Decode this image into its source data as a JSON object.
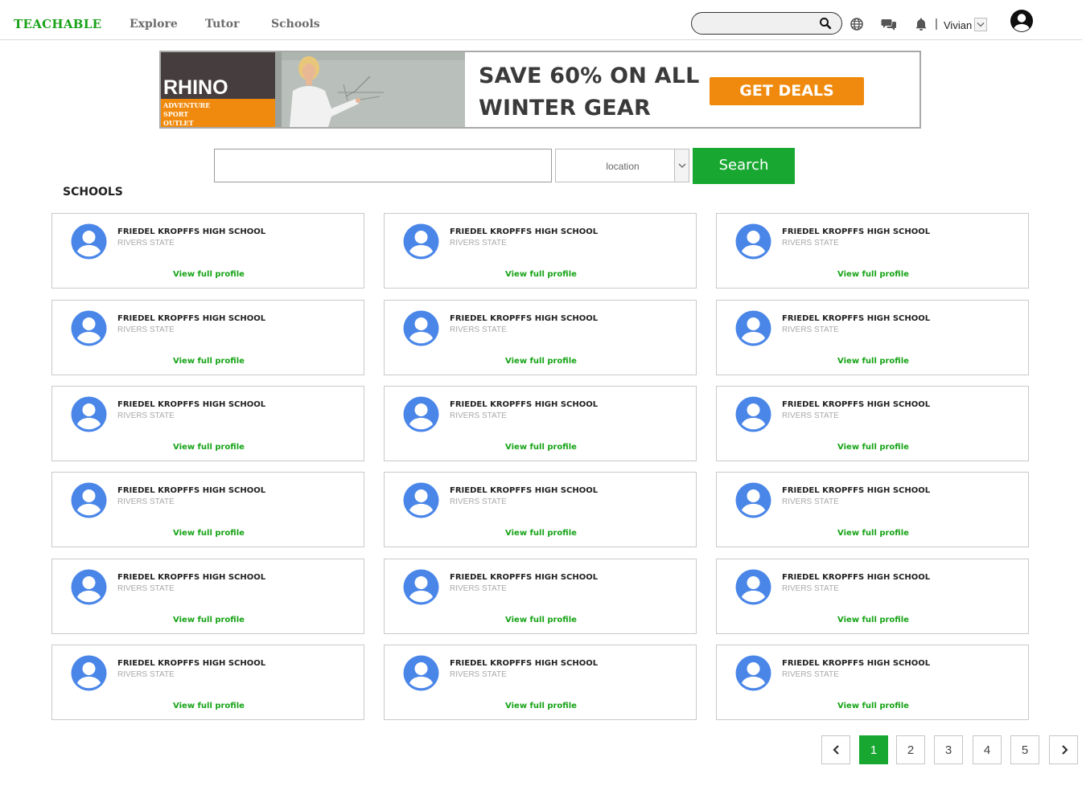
{
  "header": {
    "brand": "TEACHABLE",
    "nav": [
      "Explore",
      "Tutor",
      "Schools"
    ],
    "search_placeholder": "",
    "user_name": "Vivian",
    "divider": "|"
  },
  "banner": {
    "logo_title": "RHINO",
    "logo_lines": [
      "ADVENTURE",
      "SPORT",
      "OUTLET"
    ],
    "headline_1": "SAVE 60% ON ALL",
    "headline_2": "WINTER GEAR",
    "cta": "GET DEALS"
  },
  "search": {
    "placeholder": "",
    "location_label": "location",
    "button": "Search"
  },
  "section_title": "SCHOOLS",
  "schools": [
    {
      "name": "FRIEDEL KROPFFS HIGH SCHOOL",
      "state": "RIVERS STATE",
      "link": "View full profile"
    },
    {
      "name": "FRIEDEL KROPFFS HIGH SCHOOL",
      "state": "RIVERS STATE",
      "link": "View full profile"
    },
    {
      "name": "FRIEDEL KROPFFS HIGH SCHOOL",
      "state": "RIVERS STATE",
      "link": "View full profile"
    },
    {
      "name": "FRIEDEL KROPFFS HIGH SCHOOL",
      "state": "RIVERS STATE",
      "link": "View full profile"
    },
    {
      "name": "FRIEDEL KROPFFS HIGH SCHOOL",
      "state": "RIVERS STATE",
      "link": "View full profile"
    },
    {
      "name": "FRIEDEL KROPFFS HIGH SCHOOL",
      "state": "RIVERS STATE",
      "link": "View full profile"
    },
    {
      "name": "FRIEDEL KROPFFS HIGH SCHOOL",
      "state": "RIVERS STATE",
      "link": "View full profile"
    },
    {
      "name": "FRIEDEL KROPFFS HIGH SCHOOL",
      "state": "RIVERS STATE",
      "link": "View full profile"
    },
    {
      "name": "FRIEDEL KROPFFS HIGH SCHOOL",
      "state": "RIVERS STATE",
      "link": "View full profile"
    },
    {
      "name": "FRIEDEL KROPFFS HIGH SCHOOL",
      "state": "RIVERS STATE",
      "link": "View full profile"
    },
    {
      "name": "FRIEDEL KROPFFS HIGH SCHOOL",
      "state": "RIVERS STATE",
      "link": "View full profile"
    },
    {
      "name": "FRIEDEL KROPFFS HIGH SCHOOL",
      "state": "RIVERS STATE",
      "link": "View full profile"
    },
    {
      "name": "FRIEDEL KROPFFS HIGH SCHOOL",
      "state": "RIVERS STATE",
      "link": "View full profile"
    },
    {
      "name": "FRIEDEL KROPFFS HIGH SCHOOL",
      "state": "RIVERS STATE",
      "link": "View full profile"
    },
    {
      "name": "FRIEDEL KROPFFS HIGH SCHOOL",
      "state": "RIVERS STATE",
      "link": "View full profile"
    },
    {
      "name": "FRIEDEL KROPFFS HIGH SCHOOL",
      "state": "RIVERS STATE",
      "link": "View full profile"
    },
    {
      "name": "FRIEDEL KROPFFS HIGH SCHOOL",
      "state": "RIVERS STATE",
      "link": "View full profile"
    },
    {
      "name": "FRIEDEL KROPFFS HIGH SCHOOL",
      "state": "RIVERS STATE",
      "link": "View full profile"
    }
  ],
  "pagination": {
    "pages": [
      "1",
      "2",
      "3",
      "4",
      "5"
    ],
    "current": "1"
  },
  "colors": {
    "brand_green": "#1aa21a",
    "button_green": "#18a832",
    "banner_orange": "#f08a0e",
    "avatar_blue": "#4a86e8"
  },
  "icons": {
    "search": "search-icon",
    "globe": "globe-icon",
    "chat": "chat-icon",
    "bell": "bell-icon",
    "user": "user-circle-icon",
    "prev": "chevron-left-icon",
    "next": "chevron-right-icon"
  }
}
